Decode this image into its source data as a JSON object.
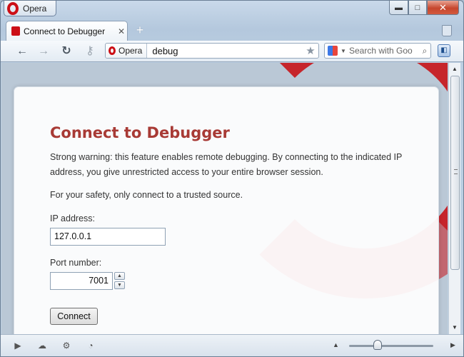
{
  "window": {
    "menu_label": "Opera",
    "controls": {
      "minimize": "▬",
      "maximize": "□",
      "close": "✕"
    }
  },
  "tabs": [
    {
      "title": "Connect to Debugger",
      "active": true
    }
  ],
  "toolbar": {
    "address_badge": "Opera",
    "address_value": "debug",
    "search_placeholder": "Search with Goo"
  },
  "page": {
    "heading": "Connect to Debugger",
    "warning": "Strong warning: this feature enables remote debugging. By connecting to the indicated IP address, you give unrestricted access to your entire browser session.",
    "safety": "For your safety, only connect to a trusted source.",
    "ip_label": "IP address:",
    "ip_value": "127.0.0.1",
    "port_label": "Port number:",
    "port_value": "7001",
    "connect_label": "Connect"
  },
  "colors": {
    "heading": "#a83a35",
    "brand_red": "#cc0f16"
  },
  "icons": {
    "back": "back-arrow-icon",
    "forward": "forward-arrow-icon",
    "reload": "reload-icon",
    "wand": "key-icon",
    "star": "star-icon",
    "search": "magnifier-icon"
  }
}
